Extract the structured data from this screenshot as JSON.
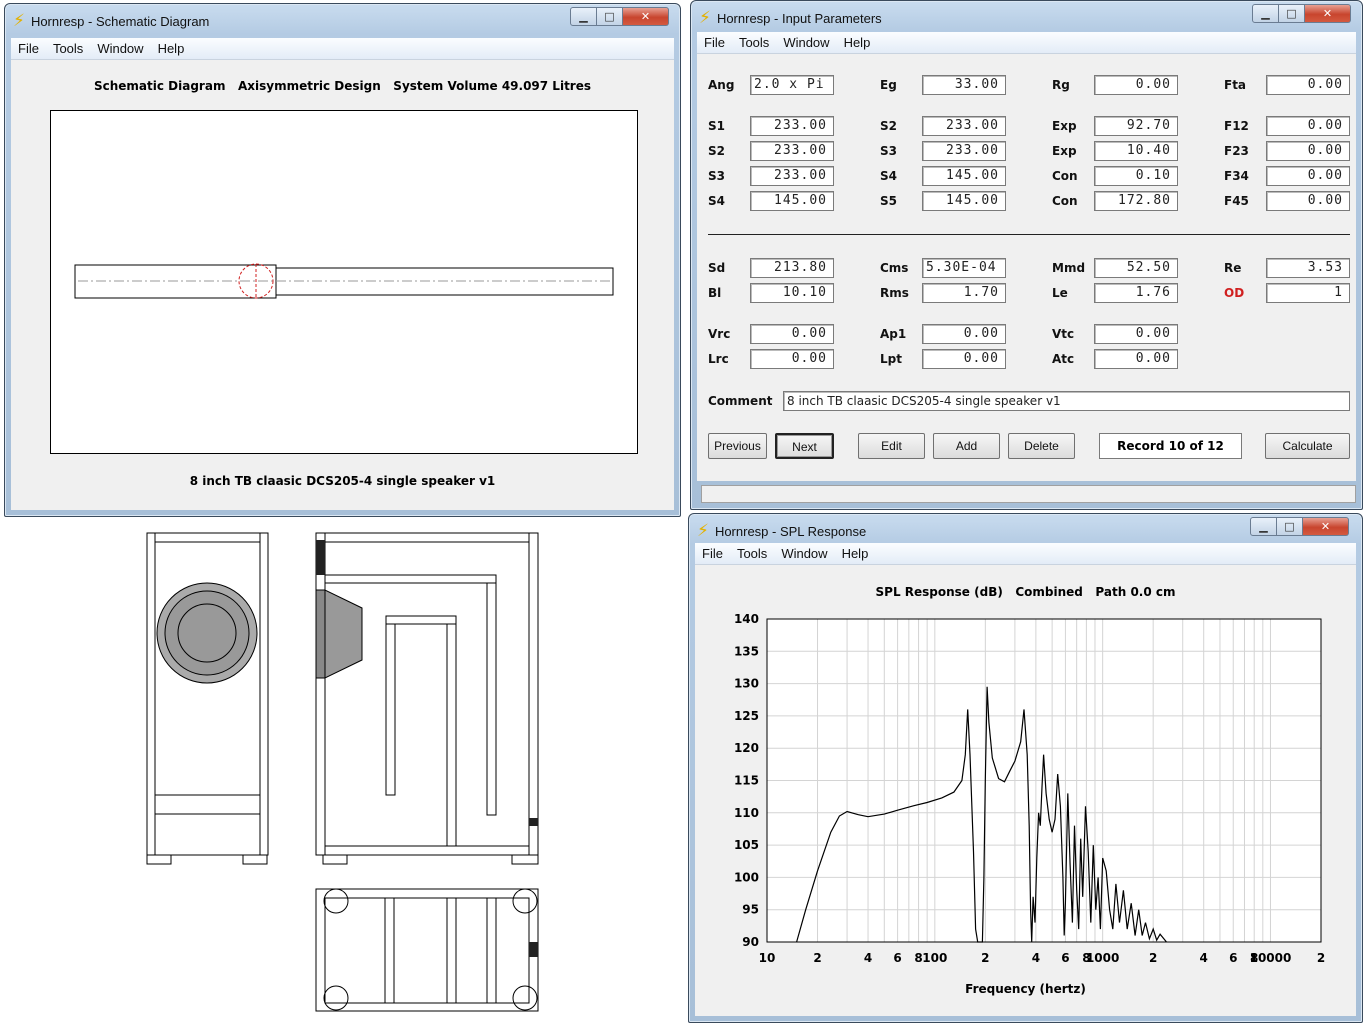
{
  "menu": {
    "file": "File",
    "tools": "Tools",
    "window": "Window",
    "help": "Help"
  },
  "schematic": {
    "title": "Hornresp - Schematic Diagram",
    "header": "Schematic Diagram   Axisymmetric Design   System Volume 49.097 Litres",
    "caption": "8 inch TB claasic DCS205-4 single speaker v1"
  },
  "input": {
    "title": "Hornresp - Input Parameters",
    "labels": {
      "ang": "Ang",
      "eg": "Eg",
      "rg": "Rg",
      "fta": "Fta",
      "s1": "S1",
      "s2b": "S2",
      "exp1": "Exp",
      "f12": "F12",
      "s2": "S2",
      "s3b": "S3",
      "exp2": "Exp",
      "f23": "F23",
      "s3": "S3",
      "s4b": "S4",
      "con1": "Con",
      "f34": "F34",
      "s4": "S4",
      "s5": "S5",
      "con2": "Con",
      "f45": "F45",
      "sd": "Sd",
      "cms": "Cms",
      "mmd": "Mmd",
      "re": "Re",
      "bl": "Bl",
      "rms": "Rms",
      "le": "Le",
      "od": "OD",
      "vrc": "Vrc",
      "ap1": "Ap1",
      "vtc": "Vtc",
      "lrc": "Lrc",
      "lpt": "Lpt",
      "atc": "Atc",
      "comment": "Comment"
    },
    "values": {
      "ang": "2.0 x Pi",
      "eg": "33.00",
      "rg": "0.00",
      "fta": "0.00",
      "s1": "233.00",
      "s2b": "233.00",
      "exp1": "92.70",
      "f12": "0.00",
      "s2": "233.00",
      "s3b": "233.00",
      "exp2": "10.40",
      "f23": "0.00",
      "s3": "233.00",
      "s4b": "145.00",
      "con1": "0.10",
      "f34": "0.00",
      "s4": "145.00",
      "s5": "145.00",
      "con2": "172.80",
      "f45": "0.00",
      "sd": "213.80",
      "cms": "5.30E-04",
      "mmd": "52.50",
      "re": "3.53",
      "bl": "10.10",
      "rms": "1.70",
      "le": "1.76",
      "od": "1",
      "vrc": "0.00",
      "ap1": "0.00",
      "vtc": "0.00",
      "lrc": "0.00",
      "lpt": "0.00",
      "atc": "0.00",
      "comment": "8 inch TB claasic DCS205-4 single speaker v1"
    },
    "buttons": {
      "previous": "Previous",
      "next": "Next",
      "edit": "Edit",
      "add": "Add",
      "delete": "Delete",
      "calculate": "Calculate"
    },
    "record": "Record 10 of 12",
    "colors": {
      "od": "#d02020"
    }
  },
  "spl": {
    "title": "Hornresp - SPL Response",
    "chart_data": {
      "type": "line",
      "title": "SPL Response (dB)   Combined   Path 0.0 cm",
      "xlabel": "Frequency (hertz)",
      "ylabel": "",
      "xscale": "log",
      "xlim": [
        10,
        20000
      ],
      "ylim": [
        90,
        140
      ],
      "yticks": [
        140,
        135,
        130,
        125,
        120,
        115,
        110,
        105,
        100,
        95,
        90
      ],
      "xticklabels": [
        {
          "v": 10,
          "t": "10"
        },
        {
          "v": 20,
          "t": "2"
        },
        {
          "v": 40,
          "t": "4"
        },
        {
          "v": 60,
          "t": "6"
        },
        {
          "v": 80,
          "t": "8"
        },
        {
          "v": 100,
          "t": "100"
        },
        {
          "v": 200,
          "t": "2"
        },
        {
          "v": 400,
          "t": "4"
        },
        {
          "v": 600,
          "t": "6"
        },
        {
          "v": 800,
          "t": "8"
        },
        {
          "v": 1000,
          "t": "1000"
        },
        {
          "v": 2000,
          "t": "2"
        },
        {
          "v": 4000,
          "t": "4"
        },
        {
          "v": 6000,
          "t": "6"
        },
        {
          "v": 8000,
          "t": "8"
        },
        {
          "v": 10000,
          "t": "10000"
        },
        {
          "v": 20000,
          "t": "2"
        }
      ],
      "grid": true,
      "series": [
        {
          "values": [
            [
              15,
              90
            ],
            [
              17,
              95
            ],
            [
              20,
              101
            ],
            [
              24,
              107
            ],
            [
              27,
              109.5
            ],
            [
              30,
              110.2
            ],
            [
              35,
              109.7
            ],
            [
              40,
              109.4
            ],
            [
              50,
              109.8
            ],
            [
              60,
              110.4
            ],
            [
              75,
              111.1
            ],
            [
              90,
              111.6
            ],
            [
              110,
              112.3
            ],
            [
              130,
              113.2
            ],
            [
              145,
              115
            ],
            [
              152,
              119
            ],
            [
              157,
              126
            ],
            [
              162,
              119
            ],
            [
              170,
              104
            ],
            [
              175,
              92
            ],
            [
              180,
              90
            ],
            [
              192,
              90
            ],
            [
              196,
              100
            ],
            [
              200,
              115
            ],
            [
              205,
              129.5
            ],
            [
              210,
              124
            ],
            [
              220,
              118.5
            ],
            [
              240,
              115.3
            ],
            [
              260,
              114.8
            ],
            [
              280,
              116.5
            ],
            [
              300,
              118
            ],
            [
              325,
              121
            ],
            [
              340,
              126
            ],
            [
              355,
              119
            ],
            [
              365,
              108
            ],
            [
              372,
              95
            ],
            [
              378,
              90
            ],
            [
              385,
              97
            ],
            [
              395,
              93
            ],
            [
              405,
              103
            ],
            [
              415,
              110
            ],
            [
              425,
              108
            ],
            [
              435,
              114
            ],
            [
              445,
              119
            ],
            [
              460,
              113
            ],
            [
              480,
              109
            ],
            [
              500,
              107
            ],
            [
              520,
              109
            ],
            [
              540,
              116
            ],
            [
              560,
              111
            ],
            [
              580,
              100
            ],
            [
              590,
              91
            ],
            [
              600,
              96
            ],
            [
              620,
              113
            ],
            [
              640,
              102
            ],
            [
              660,
              93
            ],
            [
              680,
              108
            ],
            [
              700,
              98
            ],
            [
              720,
              92
            ],
            [
              740,
              106
            ],
            [
              760,
              97
            ],
            [
              790,
              111
            ],
            [
              820,
              104
            ],
            [
              850,
              93
            ],
            [
              880,
              105
            ],
            [
              910,
              95
            ],
            [
              940,
              100
            ],
            [
              970,
              92
            ],
            [
              1000,
              103
            ],
            [
              1050,
              101
            ],
            [
              1100,
              95
            ],
            [
              1150,
              92
            ],
            [
              1200,
              99
            ],
            [
              1260,
              93
            ],
            [
              1330,
              98
            ],
            [
              1400,
              92
            ],
            [
              1480,
              96
            ],
            [
              1560,
              91
            ],
            [
              1640,
              95
            ],
            [
              1720,
              91
            ],
            [
              1800,
              93
            ],
            [
              1900,
              90.5
            ],
            [
              2000,
              92
            ],
            [
              2100,
              90.3
            ],
            [
              2200,
              91.2
            ],
            [
              2400,
              90
            ]
          ]
        }
      ]
    }
  }
}
